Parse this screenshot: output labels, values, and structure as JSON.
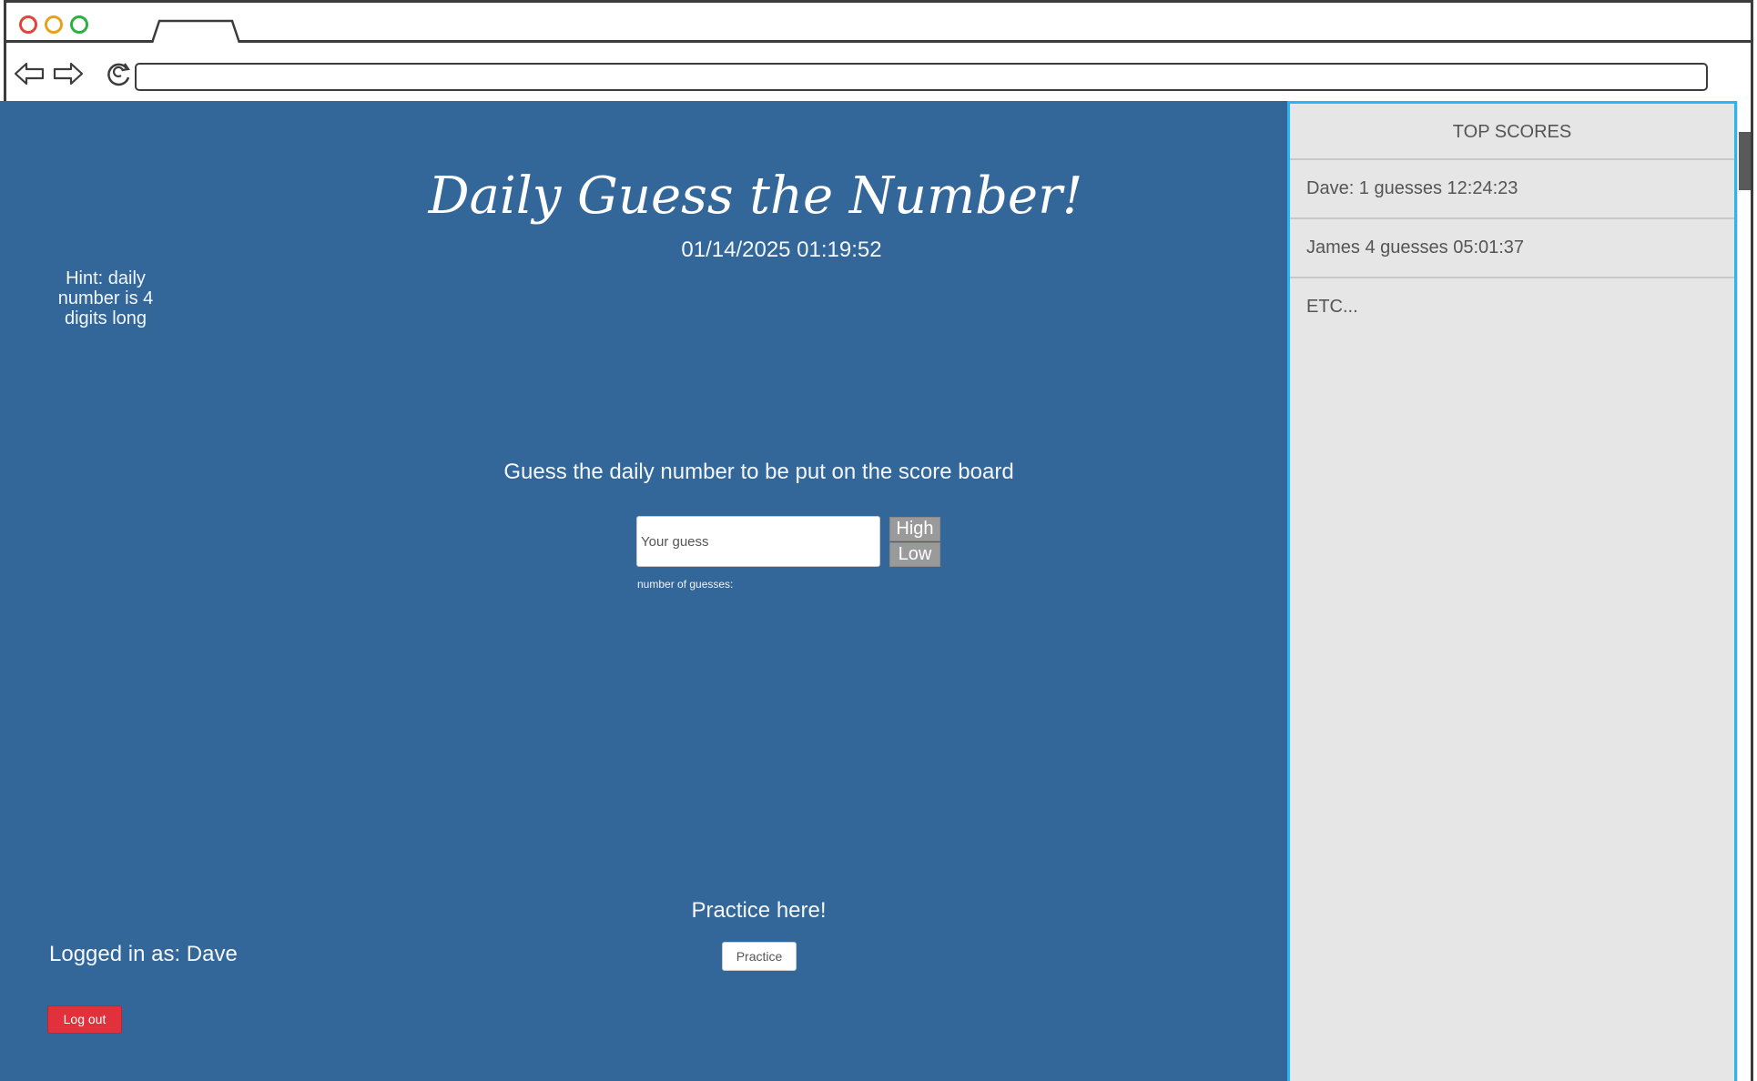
{
  "browser": {
    "url": ""
  },
  "page": {
    "title": "Daily Guess the Number!",
    "timestamp": "01/14/2025 01:19:52",
    "hint": "Hint: daily number is 4 digits long",
    "prompt": "Guess the daily number to be put on the score board",
    "guess_placeholder": "Your guess",
    "high_label": "High",
    "low_label": "Low",
    "guess_count_label": "number of guesses:",
    "practice_label": "Practice here!",
    "practice_button": "Practice",
    "logged_in": "Logged in as: Dave",
    "logout_button": "Log out"
  },
  "scoreboard": {
    "title": "TOP SCORES",
    "entries": [
      "Dave: 1 guesses 12:24:23",
      "James 4 guesses 05:01:37",
      "ETC..."
    ]
  },
  "colors": {
    "content_bg": "#336699",
    "scoreboard_bg": "#e6e6e6",
    "scoreboard_border": "#29b6f6",
    "logout_red": "#e0313d"
  }
}
